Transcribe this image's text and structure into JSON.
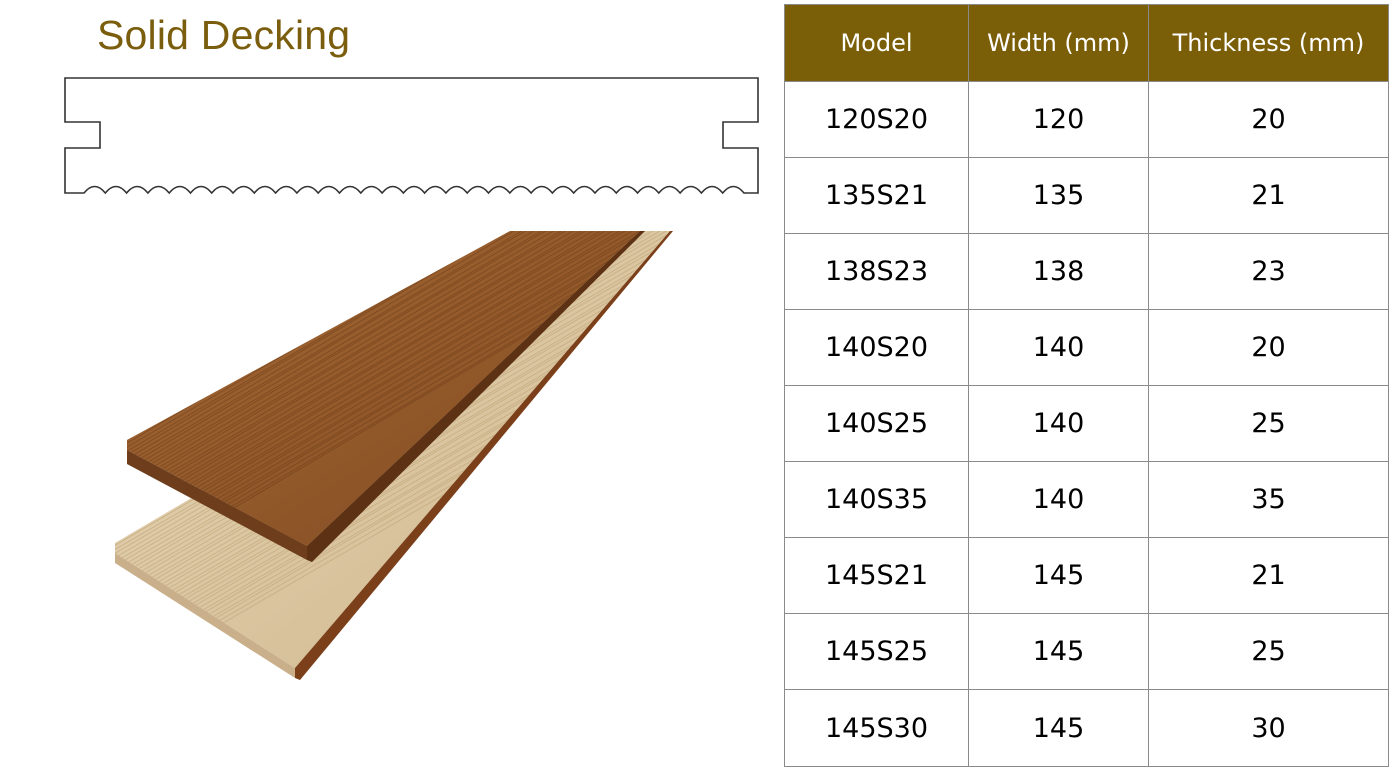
{
  "title": "Solid Decking",
  "table": {
    "headers": [
      "Model",
      "Width (mm)",
      "Thickness (mm)"
    ],
    "rows": [
      [
        "120S20",
        "120",
        "20"
      ],
      [
        "135S21",
        "135",
        "21"
      ],
      [
        "138S23",
        "138",
        "23"
      ],
      [
        "140S20",
        "140",
        "20"
      ],
      [
        "140S25",
        "140",
        "25"
      ],
      [
        "140S35",
        "140",
        "35"
      ],
      [
        "145S21",
        "145",
        "21"
      ],
      [
        "145S25",
        "145",
        "25"
      ],
      [
        "145S30",
        "145",
        "30"
      ]
    ]
  },
  "colors": {
    "title": "#7a5d0d",
    "header_bg": "#7a5e08",
    "header_text": "#ffffff",
    "board_dark": "#9a5f2c",
    "board_light": "#ddc9a4"
  }
}
